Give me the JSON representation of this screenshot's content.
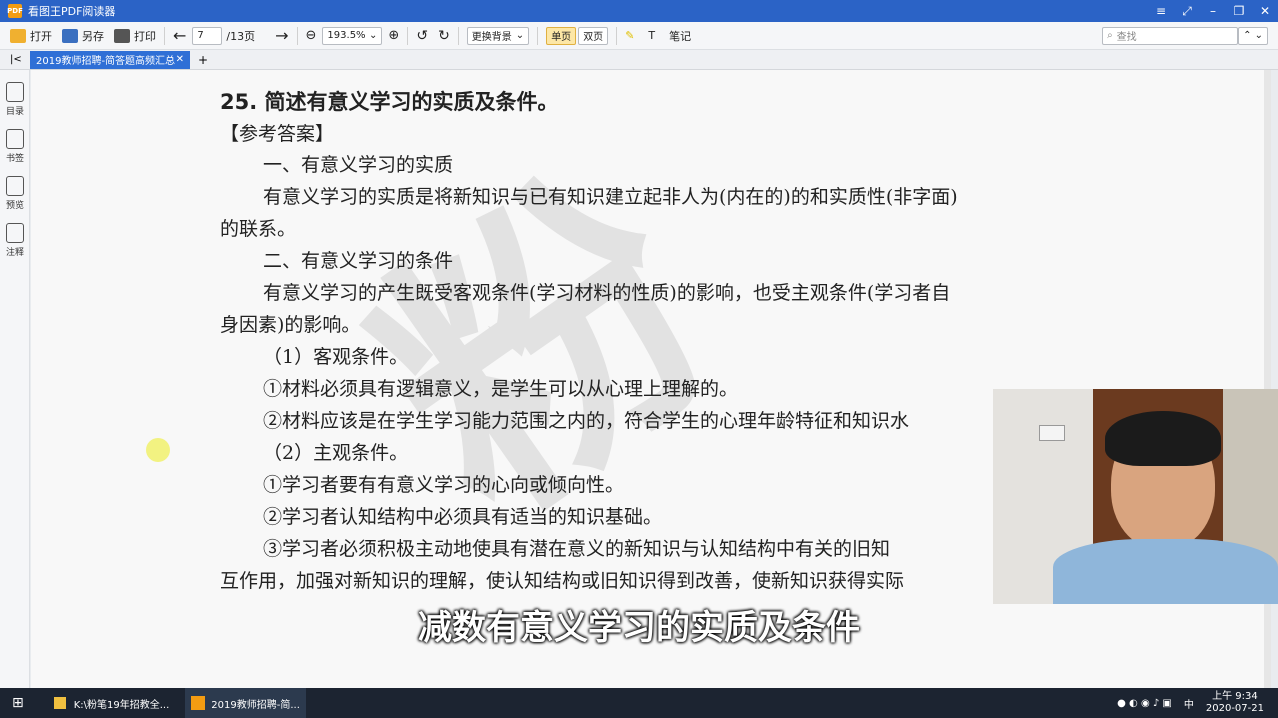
{
  "window": {
    "title": "看图王PDF阅读器",
    "app_badge": "PDF"
  },
  "toolbar": {
    "open": "打开",
    "save_as": "另存",
    "print": "打印",
    "page_current": "7",
    "page_total": "/13页",
    "zoom": "193.5%",
    "background": "更换背景",
    "single_page": "单页",
    "double_page": "双页",
    "notes": "笔记",
    "search_placeholder": "查找"
  },
  "tab": {
    "label": "2019教师招聘-简答题高频汇总"
  },
  "sidebar": {
    "items": [
      {
        "label": "目录",
        "icon": "list-icon"
      },
      {
        "label": "书签",
        "icon": "bookmark-icon"
      },
      {
        "label": "预览",
        "icon": "preview-icon"
      },
      {
        "label": "注释",
        "icon": "annotation-icon"
      }
    ]
  },
  "document": {
    "heading": "25. 简述有意义学习的实质及条件。",
    "lines": [
      "【参考答案】",
      "一、有意义学习的实质",
      "有意义学习的实质是将新知识与已有知识建立起非人为(内在的)的和实质性(非字面)",
      "的联系。",
      "二、有意义学习的条件",
      "有意义学习的产生既受客观条件(学习材料的性质)的影响，也受主观条件(学习者自",
      "身因素)的影响。",
      "（1）客观条件。",
      "①材料必须具有逻辑意义，是学生可以从心理上理解的。",
      "②材料应该是在学生学习能力范围之内的，符合学生的心理年龄特征和知识水",
      "（2）主观条件。",
      "①学习者要有有意义学习的心向或倾向性。",
      "②学习者认知结构中必须具有适当的知识基础。",
      "③学习者必须积极主动地使具有潜在意义的新知识与认知结构中有关的旧知",
      "互作用，加强对新知识的理解，使认知结构或旧知识得到改善，使新知识获得实际"
    ]
  },
  "subtitle": "减数有意义学习的实质及条件",
  "taskbar": {
    "item1": "K:\\粉笔19年招教全...",
    "item2": "2019教师招聘-简...",
    "time": "上午 9:34",
    "date": "2020-07-21",
    "ime": "中"
  }
}
